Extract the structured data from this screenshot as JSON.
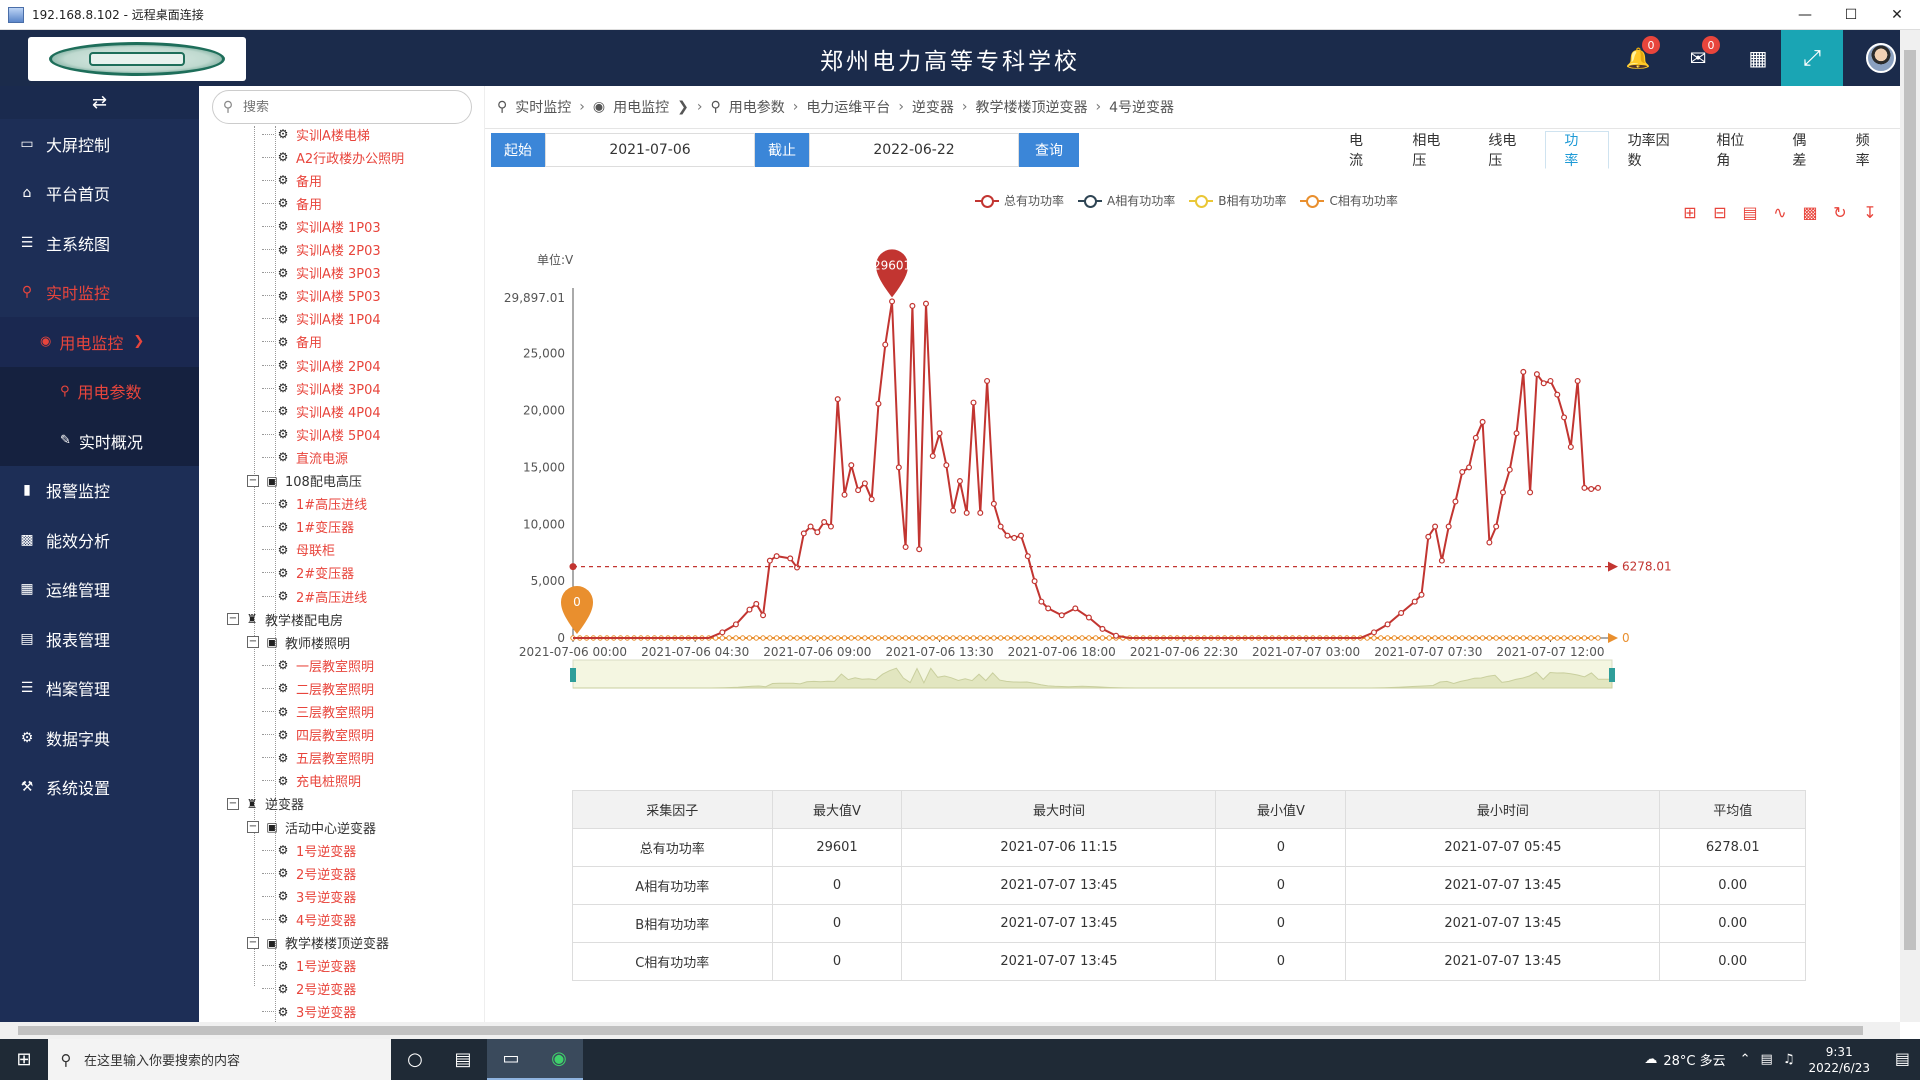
{
  "window": {
    "title": "192.168.8.102 - 远程桌面连接",
    "controls": [
      "—",
      "☐",
      "✕"
    ]
  },
  "header": {
    "title": "郑州电力高等专科学校",
    "notif_count": "0",
    "mail_count": "0"
  },
  "sidebar": {
    "toggle_icon": "⇄",
    "items": [
      {
        "label": "大屏控制",
        "icon": "monitor-icon"
      },
      {
        "label": "平台首页",
        "icon": "home-icon"
      },
      {
        "label": "主系统图",
        "icon": "server-icon"
      },
      {
        "label": "实时监控",
        "icon": "bulb-icon"
      },
      {
        "label": "用电监控",
        "icon": "eye-icon"
      },
      {
        "label": "用电参数",
        "icon": "bulb-icon"
      },
      {
        "label": "实时概况",
        "icon": "edit-icon"
      },
      {
        "label": "报警监控",
        "icon": "bookmark-icon"
      },
      {
        "label": "能效分析",
        "icon": "book-icon"
      },
      {
        "label": "运维管理",
        "icon": "calendar-icon"
      },
      {
        "label": "报表管理",
        "icon": "file-icon"
      },
      {
        "label": "档案管理",
        "icon": "server-icon"
      },
      {
        "label": "数据字典",
        "icon": "gear-icon"
      },
      {
        "label": "系统设置",
        "icon": "wrench-icon"
      }
    ]
  },
  "search": {
    "placeholder": "搜索"
  },
  "tree": {
    "r0": "实训A楼电梯",
    "r1": "A2行政楼办公照明",
    "r2": "备用",
    "r3": "备用",
    "r4": "实训A楼 1P03",
    "r5": "实训A楼 2P03",
    "r6": "实训A楼 3P03",
    "r7": "实训A楼 5P03",
    "r8": "实训A楼 1P04",
    "r9": "备用",
    "r10": "实训A楼 2P04",
    "r11": "实训A楼 3P04",
    "r12": "实训A楼 4P04",
    "r13": "实训A楼 5P04",
    "r14": "直流电源",
    "r15": "108配电高压",
    "r16": "1#高压进线",
    "r17": "1#变压器",
    "r18": "母联柜",
    "r19": "2#变压器",
    "r20": "2#高压进线",
    "r21": "教学楼配电房",
    "r22": "教师楼照明",
    "r23": "一层教室照明",
    "r24": "二层教室照明",
    "r25": "三层教室照明",
    "r26": "四层教室照明",
    "r27": "五层教室照明",
    "r28": "充电桩照明",
    "r29": "逆变器",
    "r30": "活动中心逆变器",
    "r31": "1号逆变器",
    "r32": "2号逆变器",
    "r33": "3号逆变器",
    "r34": "4号逆变器",
    "r35": "教学楼楼顶逆变器",
    "r36": "1号逆变器",
    "r37": "2号逆变器",
    "r38": "3号逆变器"
  },
  "breadcrumb": [
    "实时监控",
    "用电监控",
    "用电参数",
    "电力运维平台",
    "逆变器",
    "教学楼楼顶逆变器",
    "4号逆变器"
  ],
  "filter": {
    "start_label": "起始",
    "start_value": "2021-07-06",
    "end_label": "截止",
    "end_value": "2022-06-22",
    "query_label": "查询"
  },
  "tabs": [
    "电流",
    "相电压",
    "线电压",
    "功率",
    "功率因数",
    "相位角",
    "偶差",
    "频率"
  ],
  "active_tab": "功率",
  "toolbox_icons": [
    "zoom-icon",
    "zoom-reset-icon",
    "data-view-icon",
    "line-icon",
    "bar-icon",
    "restore-icon",
    "download-icon"
  ],
  "chart_data": {
    "type": "line",
    "unit_label": "单位:V",
    "legend": [
      "总有功功率",
      "A相有功功率",
      "B相有功功率",
      "C相有功功率"
    ],
    "colors": [
      "#c23531",
      "#2f4554",
      "#eac736",
      "#e98f2e"
    ],
    "x_tick_labels": [
      "2021-07-06 00:00",
      "2021-07-06 04:30",
      "2021-07-06 09:00",
      "2021-07-06 13:30",
      "2021-07-06 18:00",
      "2021-07-06 22:30",
      "2021-07-07 03:00",
      "2021-07-07 07:30",
      "2021-07-07 12:00"
    ],
    "y_ticks": [
      "0",
      "5,000",
      "10,000",
      "15,000",
      "20,000",
      "25,000",
      "29,897.01"
    ],
    "ylim": [
      0,
      29897.01
    ],
    "x_start": "2021-07-06 00:00",
    "x_end": "2021-07-07 13:45",
    "x_step_minutes": 15,
    "series": [
      {
        "name": "总有功功率",
        "values": [
          0,
          0,
          0,
          0,
          0,
          0,
          0,
          0,
          0,
          0,
          0,
          0,
          0,
          0,
          0,
          0,
          0,
          0,
          0,
          0,
          0,
          0,
          0,
          0,
          0,
          0,
          0,
          0,
          0,
          0,
          0,
          0,
          0,
          0,
          0,
          0,
          0,
          0,
          0,
          0,
          0,
          0,
          0,
          0,
          0,
          0,
          0,
          0,
          0,
          0,
          0,
          0,
          0,
          0,
          0,
          0,
          0,
          0,
          0,
          0,
          0,
          0,
          0,
          0,
          0,
          0,
          0,
          0,
          0,
          0,
          0,
          0,
          0,
          0,
          0,
          0,
          0,
          0,
          0,
          0,
          0,
          0,
          0,
          0,
          0,
          0,
          0,
          0,
          0,
          0,
          0,
          0,
          0,
          0,
          0,
          0,
          0,
          0,
          0,
          0,
          0,
          0,
          0,
          0,
          0,
          0,
          0,
          0,
          0,
          0,
          0,
          0,
          0,
          0,
          0,
          0,
          0,
          0,
          0,
          0,
          0,
          0,
          0,
          0,
          0,
          0,
          0,
          0,
          0,
          0,
          0,
          0,
          0,
          0,
          0,
          0,
          0,
          0,
          0,
          0,
          0,
          0,
          0,
          0,
          0,
          0,
          0,
          0,
          0,
          0,
          0,
          0,
          0,
          0,
          0,
          0,
          0,
          0,
          0,
          0,
          0,
          0,
          0,
          0,
          0,
          0,
          0,
          0,
          0,
          0,
          0,
          0,
          0,
          0,
          0,
          0,
          0,
          0,
          0,
          0,
          0,
          0,
          0,
          0,
          0,
          0,
          0,
          0,
          0,
          0,
          0,
          0,
          0,
          0,
          0,
          0,
          0,
          0,
          0,
          0,
          0,
          0,
          0,
          0,
          0,
          0,
          0,
          0,
          0,
          0,
          0,
          0,
          0,
          0,
          0,
          0,
          0,
          0,
          0,
          0,
          0,
          0,
          0,
          0,
          0,
          0,
          0,
          0,
          0,
          0,
          0,
          0,
          0,
          0,
          0,
          0,
          0,
          0,
          0,
          0,
          0,
          0,
          0,
          0,
          0,
          0,
          0,
          0,
          0,
          0,
          0,
          0,
          0,
          0,
          0,
          0,
          0,
          0,
          0,
          0,
          0,
          0,
          0,
          0,
          0,
          0,
          0,
          0,
          0,
          0,
          0,
          0,
          0,
          0,
          0,
          0,
          0,
          0,
          0,
          0,
          0,
          0,
          0,
          0,
          0,
          0,
          0,
          0,
          0,
          0,
          0,
          0,
          0,
          0,
          0,
          0,
          0,
          0,
          0,
          0,
          0,
          0,
          0,
          0,
          0,
          0,
          0,
          0,
          0,
          0,
          0,
          0,
          0,
          0,
          0,
          0,
          0,
          0,
          0,
          0,
          0,
          0,
          0,
          0,
          0,
          0,
          0,
          0,
          0,
          0,
          0,
          0,
          0,
          0,
          0,
          0,
          0,
          0,
          0,
          0,
          0,
          0,
          0,
          0,
          0,
          0,
          0,
          0,
          0,
          0,
          0,
          0,
          0,
          0,
          0,
          0,
          0,
          0,
          0,
          0,
          0,
          0,
          0,
          0,
          0,
          0,
          0,
          0,
          0,
          0,
          0,
          0,
          0,
          0,
          0,
          0,
          0,
          0,
          0,
          0,
          0,
          0,
          0,
          0,
          0,
          0,
          0,
          0,
          0,
          0,
          0,
          0,
          0,
          0,
          0,
          0,
          0,
          0,
          0,
          0,
          0,
          0,
          0,
          0,
          0,
          0,
          0,
          0,
          0,
          0,
          0,
          0,
          0,
          0,
          0,
          0,
          0,
          0,
          0,
          0,
          0,
          0,
          0,
          0,
          0,
          0,
          0,
          0,
          0,
          0,
          0,
          0,
          0,
          0,
          0,
          0,
          0,
          0,
          0,
          0,
          0,
          0,
          0,
          0,
          0,
          0,
          0,
          0,
          0,
          0,
          0,
          0,
          0,
          0,
          0,
          0,
          0,
          0,
          0,
          0,
          0,
          0,
          0,
          0,
          0,
          0,
          0,
          0,
          0,
          0,
          0,
          0,
          0,
          0,
          0,
          0,
          0,
          0,
          0,
          0,
          0,
          0,
          0,
          0,
          0,
          0,
          0,
          0,
          0,
          0,
          0,
          0,
          0,
          0,
          0,
          0,
          0,
          0,
          0,
          0,
          0,
          0,
          0,
          0,
          0,
          0,
          0,
          0,
          0,
          0,
          0,
          0,
          0,
          0,
          0,
          0,
          0,
          0,
          0,
          0,
          0,
          0,
          0,
          0,
          0,
          0,
          0,
          0,
          0,
          0,
          0,
          0,
          0,
          0,
          0,
          0,
          0,
          0,
          0,
          0,
          0,
          0,
          0,
          0,
          0,
          0,
          0,
          0,
          0,
          0,
          0,
          0,
          0,
          0,
          0,
          0,
          0,
          0,
          0,
          0,
          0,
          0,
          0,
          0,
          0,
          0,
          0,
          0,
          0,
          0,
          0,
          0,
          0,
          0,
          0,
          0,
          0,
          0,
          0,
          0,
          0,
          0,
          0,
          0,
          0,
          0,
          0,
          0,
          0,
          0,
          0,
          0,
          0,
          0,
          0,
          0,
          0,
          0,
          0,
          0,
          0,
          0,
          0,
          0,
          0,
          0,
          0,
          0,
          0,
          0,
          0,
          0,
          0,
          0,
          0,
          0,
          0,
          0,
          0,
          0,
          0,
          0,
          0,
          0,
          0,
          0,
          0,
          0,
          0,
          0,
          0,
          0,
          0,
          0,
          0,
          0,
          0,
          0,
          0,
          0
        ],
        "points": [
          [
            "2021-07-06 00:00",
            0
          ],
          [
            "2021-07-06 05:00",
            0
          ],
          [
            "2021-07-06 05:30",
            500
          ],
          [
            "2021-07-06 06:00",
            1200
          ],
          [
            "2021-07-06 06:30",
            2500
          ],
          [
            "2021-07-06 06:45",
            3000
          ],
          [
            "2021-07-06 07:00",
            2000
          ],
          [
            "2021-07-06 07:15",
            6800
          ],
          [
            "2021-07-06 07:30",
            7200
          ],
          [
            "2021-07-06 08:00",
            7000
          ],
          [
            "2021-07-06 08:15",
            6200
          ],
          [
            "2021-07-06 08:30",
            9200
          ],
          [
            "2021-07-06 08:45",
            9800
          ],
          [
            "2021-07-06 09:00",
            9300
          ],
          [
            "2021-07-06 09:15",
            10200
          ],
          [
            "2021-07-06 09:30",
            9800
          ],
          [
            "2021-07-06 09:45",
            21000
          ],
          [
            "2021-07-06 10:00",
            12600
          ],
          [
            "2021-07-06 10:15",
            15200
          ],
          [
            "2021-07-06 10:30",
            13000
          ],
          [
            "2021-07-06 10:45",
            13600
          ],
          [
            "2021-07-06 11:00",
            12200
          ],
          [
            "2021-07-06 11:15",
            20600
          ],
          [
            "2021-07-06 11:30",
            25800
          ],
          [
            "2021-07-06 11:45",
            29601
          ],
          [
            "2021-07-06 12:00",
            15000
          ],
          [
            "2021-07-06 12:15",
            8000
          ],
          [
            "2021-07-06 12:30",
            29200
          ],
          [
            "2021-07-06 12:45",
            7800
          ],
          [
            "2021-07-06 13:00",
            29400
          ],
          [
            "2021-07-06 13:15",
            16000
          ],
          [
            "2021-07-06 13:30",
            18000
          ],
          [
            "2021-07-06 13:45",
            15200
          ],
          [
            "2021-07-06 14:00",
            11200
          ],
          [
            "2021-07-06 14:15",
            13800
          ],
          [
            "2021-07-06 14:30",
            11000
          ],
          [
            "2021-07-06 14:45",
            20700
          ],
          [
            "2021-07-06 15:00",
            11000
          ],
          [
            "2021-07-06 15:15",
            22600
          ],
          [
            "2021-07-06 15:30",
            11800
          ],
          [
            "2021-07-06 15:45",
            9800
          ],
          [
            "2021-07-06 16:00",
            9000
          ],
          [
            "2021-07-06 16:15",
            8800
          ],
          [
            "2021-07-06 16:30",
            9000
          ],
          [
            "2021-07-06 16:45",
            7200
          ],
          [
            "2021-07-06 17:00",
            5000
          ],
          [
            "2021-07-06 17:15",
            3200
          ],
          [
            "2021-07-06 17:30",
            2600
          ],
          [
            "2021-07-06 18:00",
            2000
          ],
          [
            "2021-07-06 18:30",
            2600
          ],
          [
            "2021-07-06 19:00",
            1800
          ],
          [
            "2021-07-06 19:30",
            800
          ],
          [
            "2021-07-06 20:00",
            200
          ],
          [
            "2021-07-06 20:30",
            0
          ],
          [
            "2021-07-07 05:00",
            0
          ],
          [
            "2021-07-07 05:30",
            500
          ],
          [
            "2021-07-07 06:00",
            1200
          ],
          [
            "2021-07-07 06:30",
            2200
          ],
          [
            "2021-07-07 07:00",
            3200
          ],
          [
            "2021-07-07 07:15",
            3800
          ],
          [
            "2021-07-07 07:30",
            8900
          ],
          [
            "2021-07-07 07:45",
            9800
          ],
          [
            "2021-07-07 08:00",
            6800
          ],
          [
            "2021-07-07 08:15",
            9800
          ],
          [
            "2021-07-07 08:30",
            12000
          ],
          [
            "2021-07-07 08:45",
            14600
          ],
          [
            "2021-07-07 09:00",
            15000
          ],
          [
            "2021-07-07 09:15",
            17600
          ],
          [
            "2021-07-07 09:30",
            19000
          ],
          [
            "2021-07-07 09:45",
            8400
          ],
          [
            "2021-07-07 10:00",
            9800
          ],
          [
            "2021-07-07 10:15",
            12800
          ],
          [
            "2021-07-07 10:30",
            14800
          ],
          [
            "2021-07-07 10:45",
            18000
          ],
          [
            "2021-07-07 11:00",
            23400
          ],
          [
            "2021-07-07 11:15",
            12800
          ],
          [
            "2021-07-07 11:30",
            23200
          ],
          [
            "2021-07-07 11:45",
            22400
          ],
          [
            "2021-07-07 12:00",
            22600
          ],
          [
            "2021-07-07 12:15",
            21400
          ],
          [
            "2021-07-07 12:30",
            19400
          ],
          [
            "2021-07-07 12:45",
            16800
          ],
          [
            "2021-07-07 13:00",
            22600
          ],
          [
            "2021-07-07 13:15",
            13200
          ],
          [
            "2021-07-07 13:30",
            13100
          ],
          [
            "2021-07-07 13:45",
            13200
          ]
        ]
      },
      {
        "name": "A相有功功率",
        "constant": 0
      },
      {
        "name": "B相有功功率",
        "constant": 0
      },
      {
        "name": "C相有功功率",
        "constant": 0
      }
    ],
    "mark_max": {
      "label": "29601",
      "value": 29601,
      "x": "2021-07-06 11:45"
    },
    "mark_min": {
      "label": "0",
      "value": 0,
      "x": "2021-07-06 00:00"
    },
    "mark_avg": {
      "label": "6278.01",
      "value": 6278.01
    },
    "mark_end_zero": "0"
  },
  "stats_table": {
    "headers": [
      "采集因子",
      "最大值V",
      "最大时间",
      "最小值V",
      "最小时间",
      "平均值"
    ],
    "rows": [
      [
        "总有功功率",
        "29601",
        "2021-07-06 11:15",
        "0",
        "2021-07-07 05:45",
        "6278.01"
      ],
      [
        "A相有功功率",
        "0",
        "2021-07-07 13:45",
        "0",
        "2021-07-07 13:45",
        "0.00"
      ],
      [
        "B相有功功率",
        "0",
        "2021-07-07 13:45",
        "0",
        "2021-07-07 13:45",
        "0.00"
      ],
      [
        "C相有功功率",
        "0",
        "2021-07-07 13:45",
        "0",
        "2021-07-07 13:45",
        "0.00"
      ]
    ]
  },
  "taskbar": {
    "search_placeholder": "在这里输入你要搜索的内容",
    "weather": "28°C 多云",
    "time": "9:31",
    "date": "2022/6/23"
  }
}
